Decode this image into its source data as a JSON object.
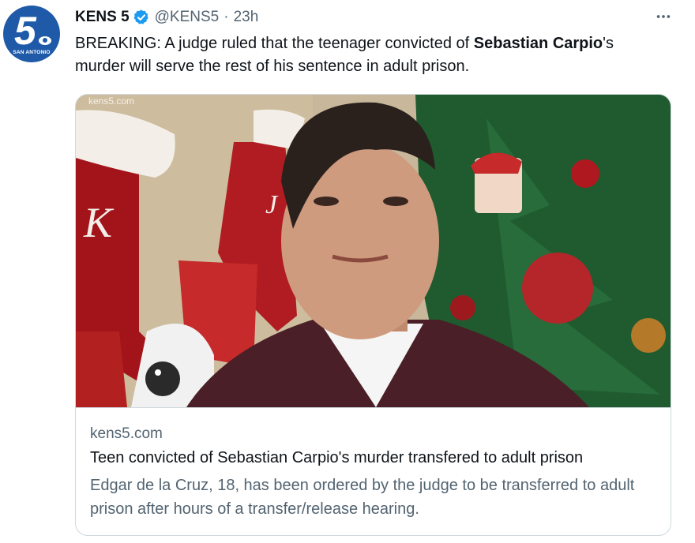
{
  "account": {
    "avatar_number": "5",
    "avatar_city": "SAN ANTONIO",
    "name": "KENS 5",
    "handle": "@KENS5",
    "separator": "·",
    "time": "23h",
    "verified": true
  },
  "menu": {
    "more_icon": "more-horizontal-icon",
    "more_label": "···"
  },
  "tweet": {
    "part1": "BREAKING: A judge ruled that the teenager convicted of ",
    "bold1": "Sebastian",
    "space": " ",
    "bold2": "Carpio",
    "part2": "'s murder will serve the rest of his sentence in adult prison."
  },
  "card": {
    "watermark": "kens5.com",
    "domain": "kens5.com",
    "title": "Teen convicted of Sebastian Carpio's murder transfered to adult prison",
    "description": "Edgar de la Cruz, 18, has been ordered by the judge to be transferred to adult prison after hours of a transfer/release hearing.",
    "stocking_letters": [
      "K",
      "J"
    ]
  },
  "colors": {
    "brand_blue": "#1f5aa8",
    "verified_blue": "#1d9bf0",
    "text": "#0f1419",
    "secondary": "#536471",
    "border": "#cfd9de"
  }
}
